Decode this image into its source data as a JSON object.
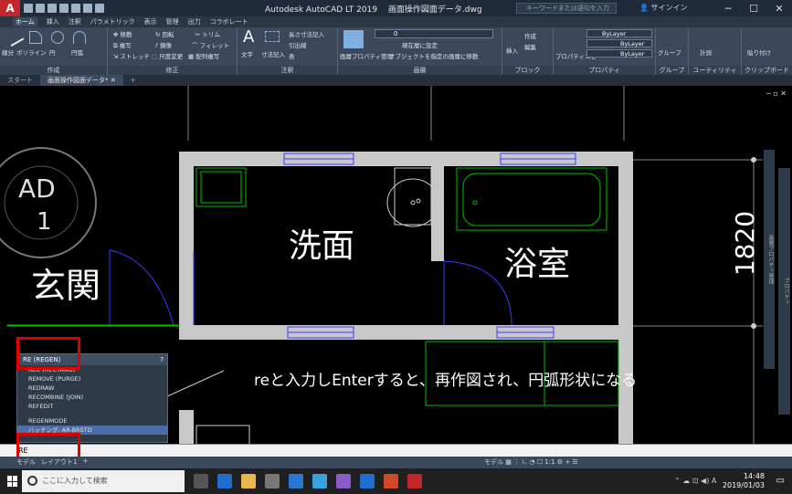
{
  "app": {
    "title": "Autodesk AutoCAD LT 2019　 画面操作図面データ.dwg",
    "search_placeholder": "キーワードまたは語句を入力",
    "signin": "サインイン",
    "icon_app": "autocad-logo-icon"
  },
  "ribbon_tabs": [
    "ホーム",
    "挿入",
    "注釈",
    "パラメトリック",
    "表示",
    "管理",
    "出力",
    "コラボレート"
  ],
  "ribbon": {
    "draw": {
      "label": "作成",
      "items": [
        "線分",
        "ポリライン",
        "円",
        "円弧"
      ]
    },
    "modify": {
      "label": "修正",
      "items": [
        "移動",
        "回転",
        "トリム",
        "複写",
        "鏡像",
        "フィレット",
        "ストレッチ",
        "尺度変更",
        "配列複写"
      ]
    },
    "annotation": {
      "label": "注釈",
      "items": [
        "文字",
        "寸法記入",
        "長さ寸法記入",
        "引出線",
        "表"
      ]
    },
    "layers": {
      "label": "画層",
      "items": [
        "画層プロパティ管理",
        "現在層に設定",
        "オブジェクトを指定の画層に移動"
      ],
      "current": "0"
    },
    "block": {
      "label": "ブロック",
      "items": [
        "挿入",
        "作成",
        "編集"
      ]
    },
    "properties": {
      "label": "プロパティ",
      "bylayer": "ByLayer",
      "items": [
        "プロパティコピー"
      ]
    },
    "groups": {
      "label": "グループ",
      "items": [
        "グループ"
      ]
    },
    "utilities": {
      "label": "ユーティリティ",
      "items": [
        "計測"
      ]
    },
    "clipboard": {
      "label": "クリップボード",
      "items": [
        "貼り付け"
      ]
    }
  },
  "file_tabs": [
    "スタート",
    "画面操作図面データ*"
  ],
  "drawing": {
    "viewcube": "AD",
    "viewport_number": "1",
    "rooms": [
      "玄関",
      "洗面",
      "浴室"
    ],
    "dimension": "1820",
    "annotation": "reと入力しEnterすると、再作図され、円弧形状になる",
    "side_panel": "画層プロパティ管理",
    "side_panel_2": "プロパティ"
  },
  "autocomplete": {
    "header": "RE (REGEN)",
    "items": [
      "REC (RECTANG)",
      "REMOVE (PURGE)",
      "REDRAW",
      "RECOMBINE (JOIN)",
      "REFEDIT",
      "REGENMODE",
      "ハッチング: AR-BRSTD"
    ]
  },
  "command_line": {
    "prompt": "RE"
  },
  "layout_tabs": [
    "モデル",
    "レイアウト1",
    "+"
  ],
  "status": {
    "model_label": "モデル",
    "scale": "1:1"
  },
  "taskbar": {
    "search_placeholder": "ここに入力して検索",
    "time": "14:48",
    "date": "2019/01/03",
    "ime": "A"
  },
  "colors": {
    "wall": "#c8c8c8",
    "fixture": "#00c000",
    "door": "#3a3aff",
    "highlight": "#e00000"
  }
}
